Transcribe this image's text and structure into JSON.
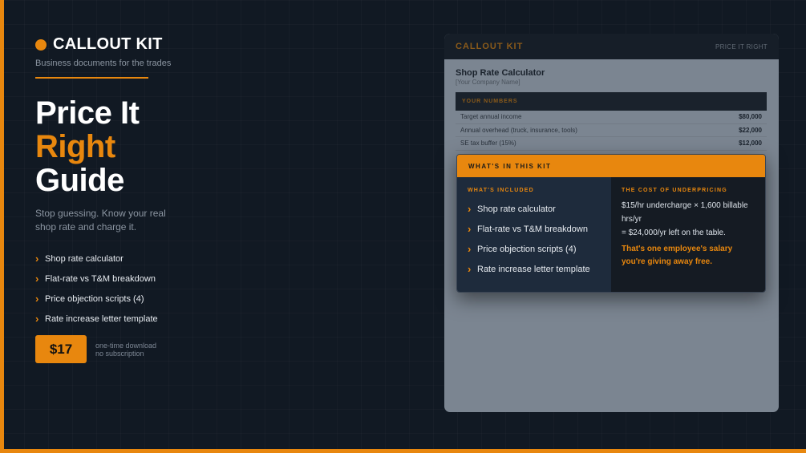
{
  "brand": {
    "name": "CALLOUT KIT",
    "tagline": "Business documents for the trades"
  },
  "headline": {
    "line1": "Price It",
    "line2": "Right",
    "line3": "Guide"
  },
  "subtext": "Stop guessing. Know your real shop rate and charge it.",
  "features": [
    "Shop rate calculator",
    "Flat-rate vs T&M breakdown",
    "Price objection scripts (4)",
    "Rate increase letter template"
  ],
  "price": {
    "amount": "$17",
    "note_line1": "one-time download",
    "note_line2": "no subscription"
  },
  "preview": {
    "brand": "CALLOUT KIT",
    "tag": "PRICE IT RIGHT",
    "doc_title": "Shop Rate Calculator",
    "doc_sub": "[Your Company Name]",
    "band_label": "YOUR NUMBERS",
    "rows": [
      {
        "label": "Target annual income",
        "value": "$80,000"
      },
      {
        "label": "Annual overhead (truck, insurance, tools)",
        "value": "$22,000"
      },
      {
        "label": "SE tax buffer (15%)",
        "value": "$12,000"
      }
    ]
  },
  "modal": {
    "title": "WHAT'S IN THIS KIT",
    "included_label": "WHAT'S INCLUDED",
    "items": [
      "Shop rate calculator",
      "Flat-rate vs T&M breakdown",
      "Price objection scripts (4)",
      "Rate increase letter template"
    ],
    "cost_label": "THE COST OF UNDERPRICING",
    "cost_line1": "$15/hr undercharge × 1,600 billable hrs/yr",
    "cost_line2": "= $24,000/yr left on the table.",
    "cost_highlight": "That's one employee's salary you're giving away free."
  },
  "colors": {
    "accent": "#e8870e",
    "background": "#111923",
    "panel": "#1e2b3c"
  }
}
